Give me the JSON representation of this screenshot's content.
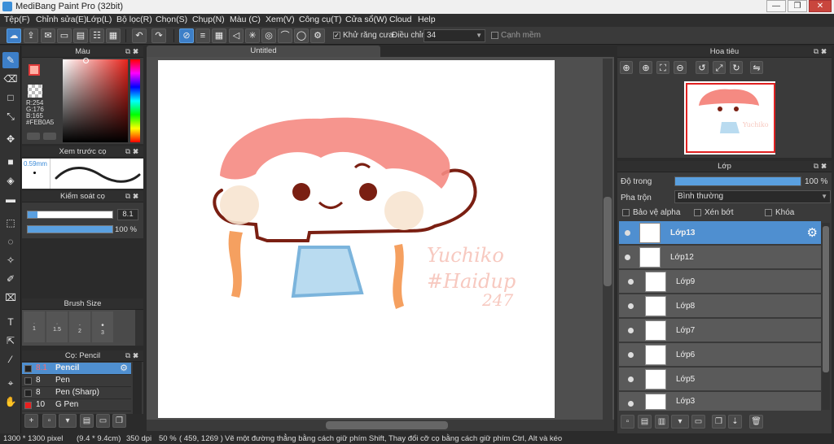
{
  "window": {
    "title": "MediBang Paint Pro (32bit)",
    "minimize": "—",
    "restore": "❐",
    "close": "✕"
  },
  "menu": [
    "Tệp(F)",
    "Chỉnh sửa(E)",
    "Lớp(L)",
    "Bộ lọc(R)",
    "Chọn(S)",
    "Chụp(N)",
    "Màu (C)",
    "Xem(V)",
    "Công cụ(T)",
    "Cửa sổ(W)",
    "Cloud",
    "Help"
  ],
  "toolbar": {
    "antialias_label": "Khử răng cưa",
    "adjust_label": "Điều chỉnh",
    "adjust_value": "34",
    "edge_label": "Cạnh mềm"
  },
  "color_panel": {
    "title": "Màu",
    "r": "R:254",
    "g": "G:176",
    "b": "B:165",
    "hex": "#FEB0A5",
    "fg_color": "#FEB0A5"
  },
  "brush_preview": {
    "title": "Xem trước cọ",
    "size": "0.59mm"
  },
  "brush_control": {
    "title": "Kiểm soát cọ",
    "size_value": "8.1",
    "opacity_value": "100 %",
    "size_fraction": 0.12,
    "opacity_fraction": 1.0
  },
  "brush_size": {
    "title": "Brush Size",
    "sizes": [
      "1",
      "1.5",
      "2",
      "3"
    ]
  },
  "brush_list": {
    "title": "Cọ: Pencil",
    "items": [
      {
        "size": "8.1",
        "name": "Pencil",
        "color": "#222222"
      },
      {
        "size": "8",
        "name": "Pen",
        "color": "#222222"
      },
      {
        "size": "8",
        "name": "Pen (Sharp)",
        "color": "#222222"
      },
      {
        "size": "10",
        "name": "G Pen",
        "color": "#e82020"
      }
    ]
  },
  "document": {
    "tab_title": "Untitled"
  },
  "canvas_text": {
    "line1": "Yuchiko",
    "line2": "#Haidup",
    "line3": "247"
  },
  "navigator": {
    "title": "Hoa tiêu"
  },
  "layer_panel": {
    "title": "Lớp",
    "opacity_label": "Độ trong",
    "opacity_value": "100 %",
    "opacity_fraction": 1.0,
    "blend_label": "Pha trộn",
    "blend_value": "Bình thường",
    "protect_alpha": "Bảo vệ alpha",
    "clip": "Xén bớt",
    "lock": "Khóa",
    "layers": [
      "Lớp13",
      "Lớp12",
      "Lớp9",
      "Lớp8",
      "Lớp7",
      "Lớp6",
      "Lớp5",
      "Lớp3"
    ]
  },
  "status": {
    "size": "1300 * 1300 pixel",
    "cm": "(9.4 * 9.4cm)",
    "dpi": "350 dpi",
    "zoom": "50 %",
    "coords": "( 459, 1269 )",
    "hint": "Vẽ một đường thẳng bằng cách giữ phím Shift, Thay đổi cỡ cọ bằng cách giữ phím Ctrl, Alt và kéo"
  }
}
